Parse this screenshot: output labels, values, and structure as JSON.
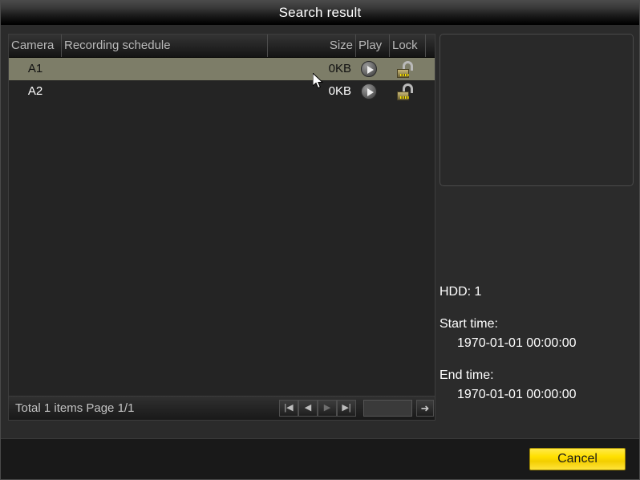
{
  "window": {
    "title": "Search result"
  },
  "table": {
    "columns": [
      {
        "key": "camera",
        "label": "Camera"
      },
      {
        "key": "schedule",
        "label": "Recording schedule"
      },
      {
        "key": "size",
        "label": "Size"
      },
      {
        "key": "play",
        "label": "Play"
      },
      {
        "key": "lock",
        "label": "Lock"
      }
    ],
    "rows": [
      {
        "camera": "A1",
        "schedule": "",
        "size": "0KB",
        "play_icon": "play-circle-icon",
        "lock_icon": "unlock-icon",
        "selected": true
      },
      {
        "camera": "A2",
        "schedule": "",
        "size": "0KB",
        "play_icon": "play-circle-icon",
        "lock_icon": "unlock-icon",
        "selected": false
      }
    ]
  },
  "pagination": {
    "total_text": "Total 1 items Page 1/1",
    "first_label": "|◀",
    "prev_label": "◀",
    "next_label": "▶",
    "last_label": "▶|",
    "page_input_value": "",
    "page_input_placeholder": "",
    "go_label": "➜"
  },
  "details": {
    "hdd_label": "HDD: 1",
    "start_label": "Start time:",
    "start_value": "1970-01-01 00:00:00",
    "end_label": "End time:",
    "end_value": "1970-01-01 00:00:00"
  },
  "footer": {
    "cancel_label": "Cancel"
  },
  "colors": {
    "selected_row": "#7d7d68",
    "accent_button": "#ffe000",
    "panel_bg": "#242424",
    "window_bg": "#2b2b2b"
  }
}
